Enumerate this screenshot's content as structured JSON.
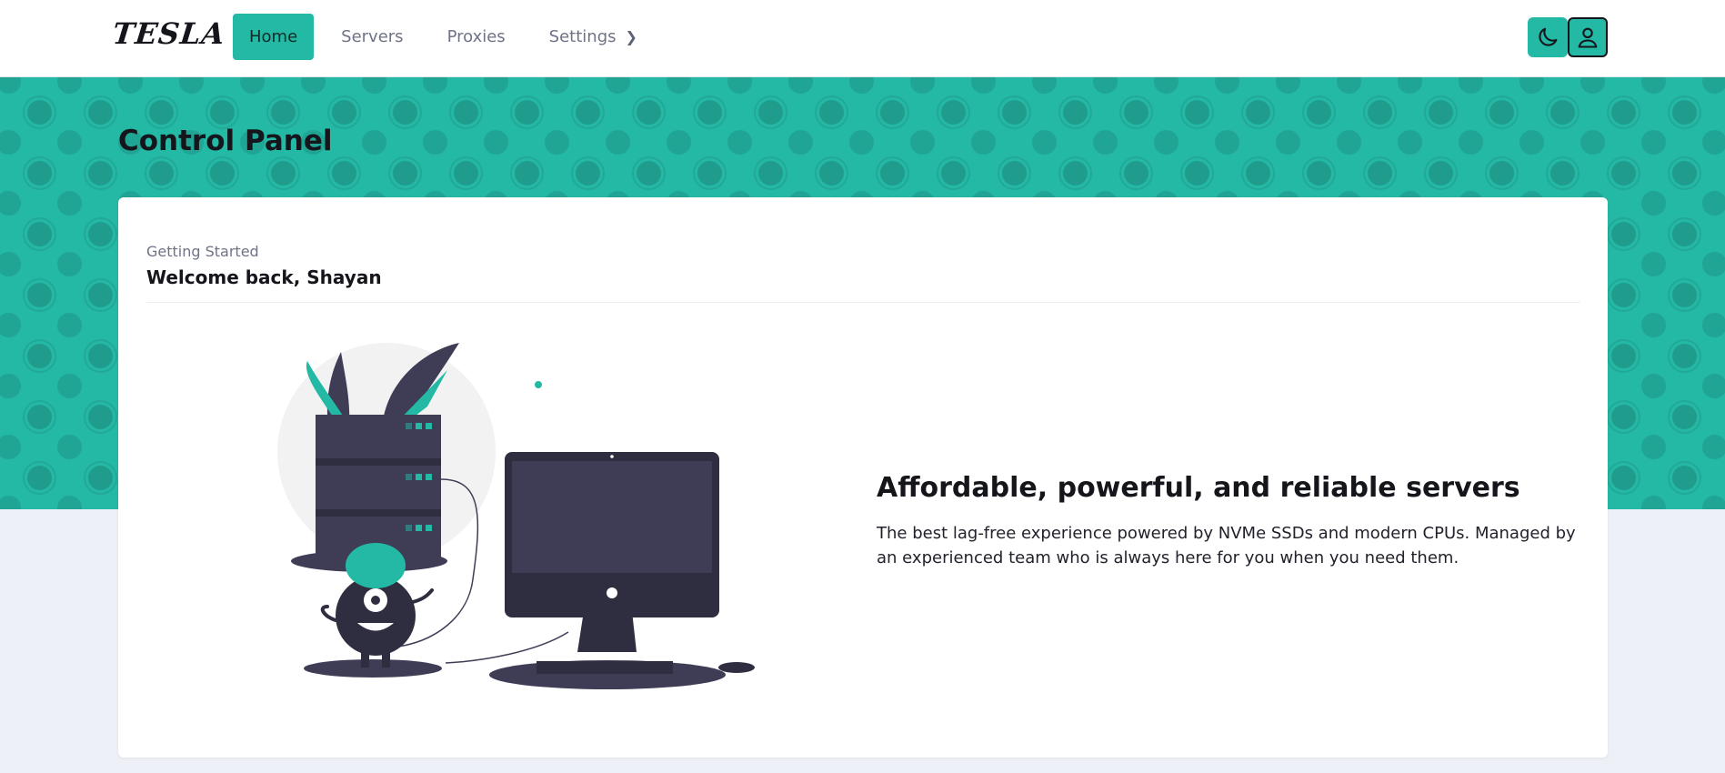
{
  "app": {
    "logo_text": "TESLA"
  },
  "nav": {
    "items": [
      {
        "label": "Home",
        "active": true
      },
      {
        "label": "Servers",
        "active": false
      },
      {
        "label": "Proxies",
        "active": false
      },
      {
        "label": "Settings",
        "active": false,
        "has_chevron": true
      }
    ]
  },
  "header_actions": {
    "theme_toggle_icon": "moon-icon",
    "account_icon": "user-icon"
  },
  "page": {
    "title": "Control Panel"
  },
  "card": {
    "subtitle": "Getting Started",
    "heading": "Welcome back, Shayan",
    "promo_title": "Affordable, powerful, and reliable servers",
    "promo_text": "The best lag-free experience powered by NVMe SSDs and modern CPUs. Managed by an experienced team who is always here for you when you need them."
  },
  "colors": {
    "accent": "#24b9a5",
    "dark": "#15151c",
    "illustration_dark": "#3f3d56",
    "background": "#eef0f7"
  }
}
